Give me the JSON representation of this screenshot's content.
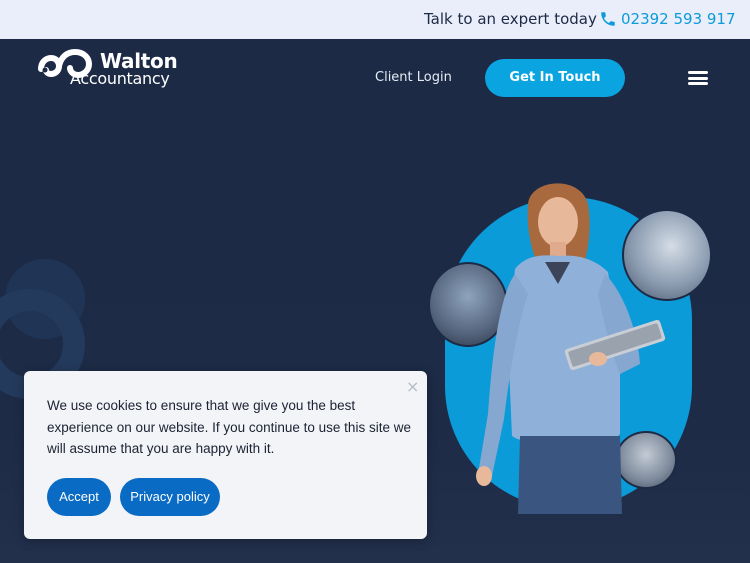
{
  "topbar": {
    "talk_text": "Talk to an expert today",
    "phone_icon": "phone-icon",
    "phone": "02392 593 917"
  },
  "header": {
    "logo_line1": "Walton",
    "logo_line2": "Accountancy",
    "client_login": "Client Login",
    "cta": "Get In Touch",
    "menu_icon": "hamburger-menu-icon"
  },
  "cookie": {
    "message": "We use cookies to ensure that we give you the best experience on our website. If you continue to use this site we will assume that you are happy with it.",
    "close": "×",
    "accept_label": "Accept",
    "privacy_label": "Privacy policy"
  },
  "colors": {
    "navy": "#1c2a45",
    "accent": "#0aa5e0",
    "topbar_bg": "#e9eefa",
    "cookie_button": "#0a6bc4"
  }
}
